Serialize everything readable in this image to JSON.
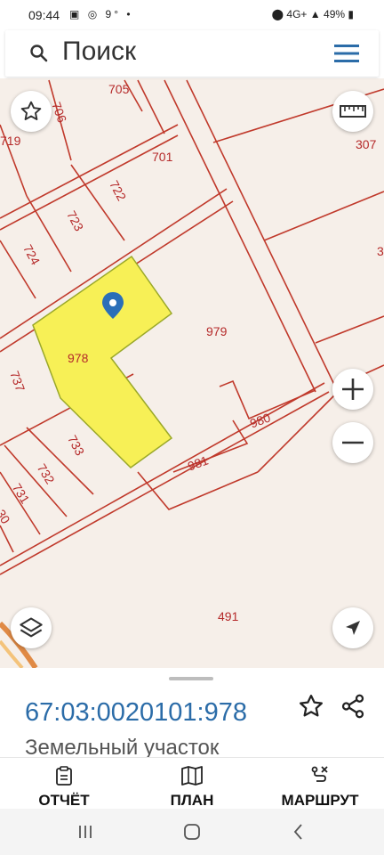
{
  "status": {
    "time": "09:44",
    "left_icons": [
      "image-icon",
      "instagram-icon",
      "9°",
      "•"
    ],
    "network": "4G+",
    "battery": "49%"
  },
  "search": {
    "placeholder": "Поиск"
  },
  "map": {
    "highlight_color": "#f7f056",
    "border_color": "#c0392b",
    "label_color": "#b52a2a",
    "parcels": [
      "705",
      "706",
      "719",
      "701",
      "307",
      "722",
      "723",
      "724",
      "979",
      "978",
      "737",
      "980",
      "733",
      "981",
      "732",
      "731",
      "30",
      "491",
      "3"
    ]
  },
  "map_buttons": [
    "star-icon",
    "ruler-icon",
    "zoom-in-icon",
    "zoom-out-icon",
    "layers-icon",
    "navigation-icon"
  ],
  "sheet": {
    "cadastral_number": "67:03:0020101:978",
    "type": "Земельный участок"
  },
  "actions": [
    {
      "label": "ОТЧЁТ",
      "icon": "report-icon"
    },
    {
      "label": "ПЛАН",
      "icon": "map-plan-icon"
    },
    {
      "label": "МАРШРУТ",
      "icon": "route-icon"
    }
  ],
  "nav": [
    "recent-apps-icon",
    "home-icon",
    "back-icon"
  ],
  "colors": {
    "accent": "#2b6ca8",
    "parcel_line": "#c0392b",
    "highlight": "#f7f056"
  }
}
